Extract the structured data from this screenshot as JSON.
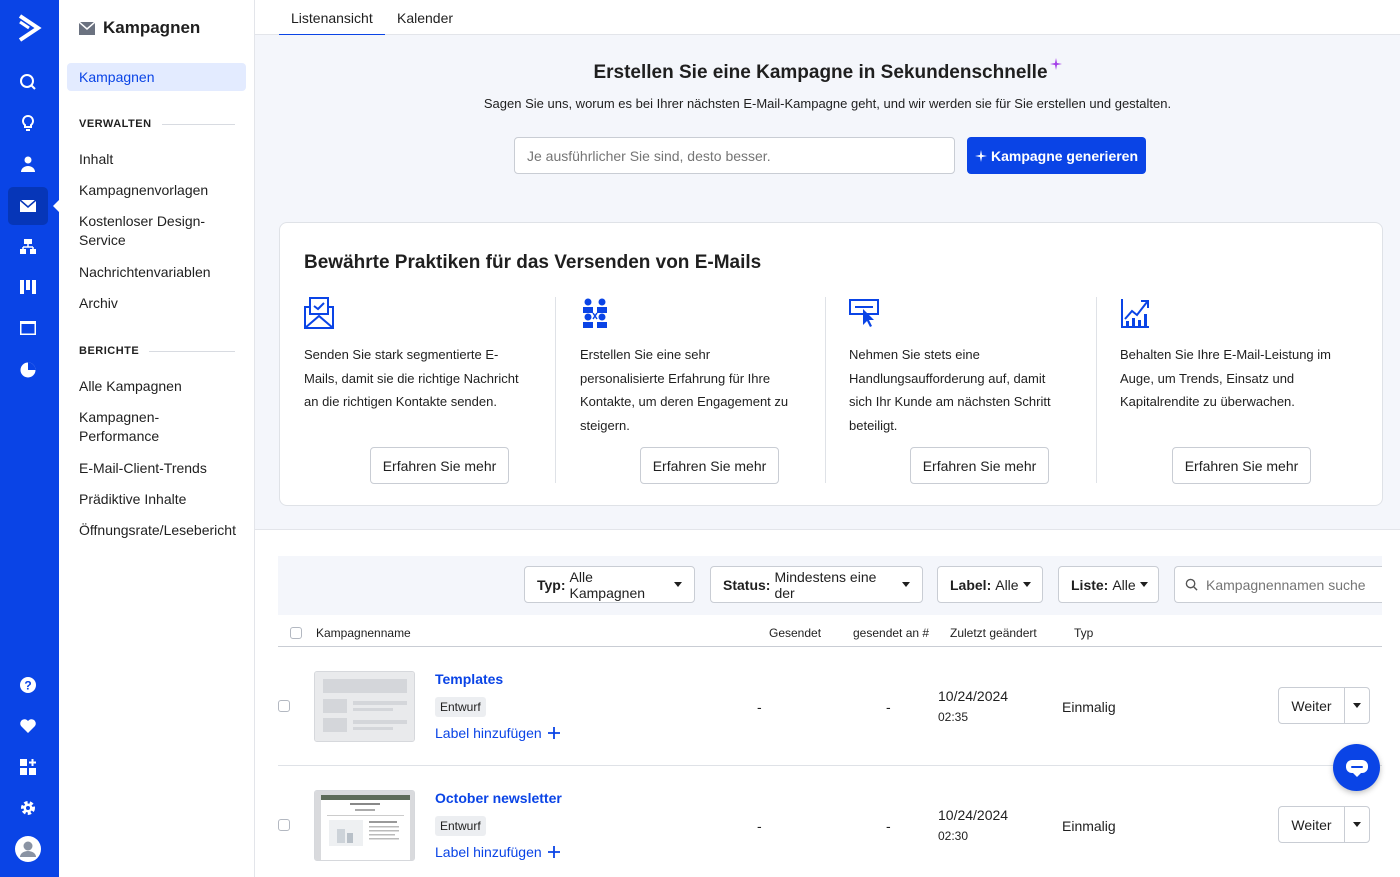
{
  "colors": {
    "brand": "#0a44e6",
    "active_bg": "#e3ebff",
    "hero_bg": "#f4f6fb"
  },
  "rail": {
    "icons": [
      "logo-icon",
      "search-icon",
      "lightbulb-icon",
      "contacts-icon",
      "email-icon",
      "automation-icon",
      "pipeline-icon",
      "website-icon",
      "reports-icon",
      "help-icon",
      "heart-icon",
      "apps-icon",
      "settings-icon",
      "avatar-icon"
    ]
  },
  "sidebar": {
    "title": "Kampagnen",
    "active_item": "Kampagnen",
    "section_manage": "VERWALTEN",
    "manage_items": [
      "Inhalt",
      "Kampagnenvorlagen",
      "Kostenloser Design-Service",
      "Nachrichtenvariablen",
      "Archiv"
    ],
    "section_reports": "BERICHTE",
    "report_items": [
      "Alle Kampagnen",
      "Kampagnen-Performance",
      "E-Mail-Client-Trends",
      "Prädiktive Inhalte",
      "Öffnungsrate/Lesebericht"
    ]
  },
  "tabs": [
    "Listenansicht",
    "Kalender"
  ],
  "hero": {
    "title": "Erstellen Sie eine Kampagne in Sekundenschnelle",
    "subtitle": "Sagen Sie uns, worum es bei Ihrer nächsten E-Mail-Kampagne geht, und wir werden sie für Sie erstellen und gestalten.",
    "input_placeholder": "Je ausführlicher Sie sind, desto besser.",
    "generate_label": "Kampagne generieren"
  },
  "best_practices": {
    "title": "Bewährte Praktiken für das Versenden von E-Mails",
    "cards": [
      {
        "text": "Senden Sie stark segmentierte E-Mails, damit sie die richtige Nachricht an die richtigen Kontakte senden.",
        "button": "Erfahren Sie mehr"
      },
      {
        "text": "Erstellen Sie eine sehr personalisierte Erfahrung für Ihre Kontakte, um deren Engagement zu steigern.",
        "button": "Erfahren Sie mehr"
      },
      {
        "text": "Nehmen Sie stets eine Handlungsaufforderung auf, damit sich Ihr Kunde am nächsten Schritt beteiligt.",
        "button": "Erfahren Sie mehr"
      },
      {
        "text": "Behalten Sie Ihre E-Mail-Leistung im Auge, um Trends, Einsatz und Kapitalrendite zu überwachen.",
        "button": "Erfahren Sie mehr"
      }
    ]
  },
  "filters": {
    "type_label": "Typ:",
    "type_value": "Alle Kampagnen",
    "status_label": "Status:",
    "status_value": "Mindestens eine der",
    "tag_label": "Label:",
    "tag_value": "Alle",
    "list_label": "Liste:",
    "list_value": "Alle",
    "search_placeholder": "Kampagnennamen suchen"
  },
  "table": {
    "headers": {
      "name": "Kampagnenname",
      "sent": "Gesendet",
      "sent_to": "gesendet an #",
      "modified": "Zuletzt geändert",
      "type": "Typ"
    },
    "rows": [
      {
        "name": "Templates",
        "status": "Entwurf",
        "add_label": "Label hinzufügen",
        "sent": "-",
        "sent_to": "-",
        "date": "10/24/2024",
        "time": "02:35",
        "type": "Einmalig",
        "action": "Weiter"
      },
      {
        "name": "October newsletter",
        "status": "Entwurf",
        "add_label": "Label hinzufügen",
        "sent": "-",
        "sent_to": "-",
        "date": "10/24/2024",
        "time": "02:30",
        "type": "Einmalig",
        "action": "Weiter"
      }
    ]
  }
}
